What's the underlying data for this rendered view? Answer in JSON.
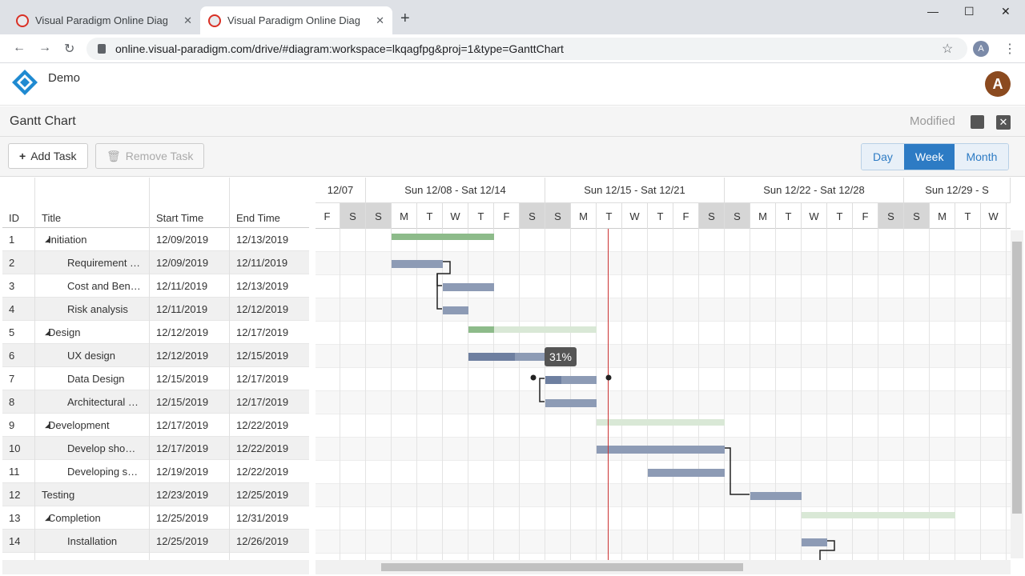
{
  "browser": {
    "tabs": [
      {
        "title": "Visual Paradigm Online Diagrams",
        "active": false
      },
      {
        "title": "Visual Paradigm Online Diagrams",
        "active": true
      }
    ],
    "url": "online.visual-paradigm.com/drive/#diagram:workspace=lkqagfpg&proj=1&type=GanttChart",
    "profile_initial": "A"
  },
  "app": {
    "name": "Demo",
    "avatar_initial": "A"
  },
  "document": {
    "title": "Gantt Chart",
    "status": "Modified"
  },
  "toolbar": {
    "add_task": "Add Task",
    "remove_task": "Remove Task",
    "views": [
      "Day",
      "Week",
      "Month"
    ],
    "selected_view": "Week"
  },
  "grid": {
    "headers": {
      "id": "ID",
      "title": "Title",
      "start": "Start Time",
      "end": "End Time"
    },
    "rows": [
      {
        "id": "1",
        "title": "Initiation",
        "start": "12/09/2019",
        "end": "12/13/2019",
        "level": 0,
        "group": true
      },
      {
        "id": "2",
        "title": "Requirement …",
        "start": "12/09/2019",
        "end": "12/11/2019",
        "level": 1,
        "group": false
      },
      {
        "id": "3",
        "title": "Cost and Ben…",
        "start": "12/11/2019",
        "end": "12/13/2019",
        "level": 1,
        "group": false
      },
      {
        "id": "4",
        "title": "Risk analysis",
        "start": "12/11/2019",
        "end": "12/12/2019",
        "level": 1,
        "group": false
      },
      {
        "id": "5",
        "title": "Design",
        "start": "12/12/2019",
        "end": "12/17/2019",
        "level": 0,
        "group": true
      },
      {
        "id": "6",
        "title": "UX design",
        "start": "12/12/2019",
        "end": "12/15/2019",
        "level": 1,
        "group": false
      },
      {
        "id": "7",
        "title": "Data Design",
        "start": "12/15/2019",
        "end": "12/17/2019",
        "level": 1,
        "group": false
      },
      {
        "id": "8",
        "title": "Architectural …",
        "start": "12/15/2019",
        "end": "12/17/2019",
        "level": 1,
        "group": false
      },
      {
        "id": "9",
        "title": "Development",
        "start": "12/17/2019",
        "end": "12/22/2019",
        "level": 0,
        "group": true
      },
      {
        "id": "10",
        "title": "Develop sho…",
        "start": "12/17/2019",
        "end": "12/22/2019",
        "level": 1,
        "group": false
      },
      {
        "id": "11",
        "title": "Developing s…",
        "start": "12/19/2019",
        "end": "12/22/2019",
        "level": 1,
        "group": false
      },
      {
        "id": "12",
        "title": "Testing",
        "start": "12/23/2019",
        "end": "12/25/2019",
        "level": 0,
        "group": false
      },
      {
        "id": "13",
        "title": "Completion",
        "start": "12/25/2019",
        "end": "12/31/2019",
        "level": 0,
        "group": true
      },
      {
        "id": "14",
        "title": "Installation",
        "start": "12/25/2019",
        "end": "12/26/2019",
        "level": 1,
        "group": false
      }
    ]
  },
  "timeline": {
    "weeks": [
      "12/07",
      "Sun 12/08 - Sat 12/14",
      "Sun 12/15 - Sat 12/21",
      "Sun 12/22 - Sat 12/28",
      "Sun 12/29 - S"
    ],
    "days": [
      "F",
      "S",
      "S",
      "M",
      "T",
      "W",
      "T",
      "F",
      "S",
      "S",
      "M",
      "T",
      "W",
      "T",
      "F",
      "S",
      "S",
      "M",
      "T",
      "W",
      "T",
      "F",
      "S",
      "S",
      "M",
      "T",
      "W"
    ],
    "weekend_flags": [
      0,
      1,
      1,
      0,
      0,
      0,
      0,
      0,
      1,
      1,
      0,
      0,
      0,
      0,
      0,
      1,
      1,
      0,
      0,
      0,
      0,
      0,
      1,
      1,
      0,
      0,
      0
    ],
    "bars": [
      {
        "row": 0,
        "startDay": 3,
        "days": 4,
        "progress": 1.0,
        "summary": true
      },
      {
        "row": 1,
        "startDay": 3,
        "days": 2,
        "progress": 0,
        "summary": false
      },
      {
        "row": 2,
        "startDay": 5,
        "days": 2,
        "progress": 0,
        "summary": false
      },
      {
        "row": 3,
        "startDay": 5,
        "days": 1,
        "progress": 0,
        "summary": false
      },
      {
        "row": 4,
        "startDay": 6,
        "days": 5,
        "progress": 0.2,
        "summary": true
      },
      {
        "row": 5,
        "startDay": 6,
        "days": 3,
        "progress": 0.6,
        "summary": false
      },
      {
        "row": 6,
        "startDay": 9,
        "days": 2,
        "progress": 0.31,
        "summary": false
      },
      {
        "row": 7,
        "startDay": 9,
        "days": 2,
        "progress": 0,
        "summary": false
      },
      {
        "row": 8,
        "startDay": 11,
        "days": 5,
        "progress": 0,
        "summary": true
      },
      {
        "row": 9,
        "startDay": 11,
        "days": 5,
        "progress": 0,
        "summary": false
      },
      {
        "row": 10,
        "startDay": 13,
        "days": 3,
        "progress": 0,
        "summary": false
      },
      {
        "row": 11,
        "startDay": 17,
        "days": 2,
        "progress": 0,
        "summary": false
      },
      {
        "row": 12,
        "startDay": 19,
        "days": 6,
        "progress": 0,
        "summary": true
      },
      {
        "row": 13,
        "startDay": 19,
        "days": 1,
        "progress": 0,
        "summary": false
      }
    ],
    "tooltip": "31%"
  }
}
